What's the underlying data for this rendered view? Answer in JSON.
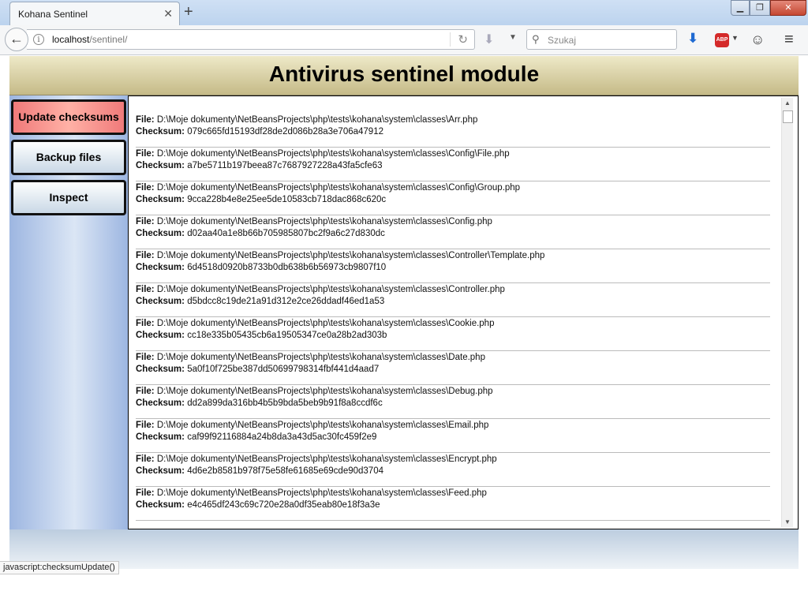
{
  "browser": {
    "tab_title": "Kohana Sentinel",
    "url_host": "localhost",
    "url_path": "/sentinel/",
    "search_placeholder": "Szukaj",
    "abp_label": "ABP",
    "status_text": "javascript:checksumUpdate()"
  },
  "page": {
    "title": "Antivirus sentinel module",
    "menu": [
      {
        "label": "Update checksums"
      },
      {
        "label": "Backup files"
      },
      {
        "label": "Inspect"
      }
    ],
    "file_label": "File:",
    "checksum_label": "Checksum:",
    "entries": [
      {
        "file": "D:\\Moje dokumenty\\NetBeansProjects\\php\\tests\\kohana\\system\\classes\\Arr.php",
        "checksum": "079c665fd15193df28de2d086b28a3e706a47912"
      },
      {
        "file": "D:\\Moje dokumenty\\NetBeansProjects\\php\\tests\\kohana\\system\\classes\\Config\\File.php",
        "checksum": "a7be5711b197beea87c7687927228a43fa5cfe63"
      },
      {
        "file": "D:\\Moje dokumenty\\NetBeansProjects\\php\\tests\\kohana\\system\\classes\\Config\\Group.php",
        "checksum": "9cca228b4e8e25ee5de10583cb718dac868c620c"
      },
      {
        "file": "D:\\Moje dokumenty\\NetBeansProjects\\php\\tests\\kohana\\system\\classes\\Config.php",
        "checksum": "d02aa40a1e8b66b705985807bc2f9a6c27d830dc"
      },
      {
        "file": "D:\\Moje dokumenty\\NetBeansProjects\\php\\tests\\kohana\\system\\classes\\Controller\\Template.php",
        "checksum": "6d4518d0920b8733b0db638b6b56973cb9807f10"
      },
      {
        "file": "D:\\Moje dokumenty\\NetBeansProjects\\php\\tests\\kohana\\system\\classes\\Controller.php",
        "checksum": "d5bdcc8c19de21a91d312e2ce26ddadf46ed1a53"
      },
      {
        "file": "D:\\Moje dokumenty\\NetBeansProjects\\php\\tests\\kohana\\system\\classes\\Cookie.php",
        "checksum": "cc18e335b05435cb6a19505347ce0a28b2ad303b"
      },
      {
        "file": "D:\\Moje dokumenty\\NetBeansProjects\\php\\tests\\kohana\\system\\classes\\Date.php",
        "checksum": "5a0f10f725be387dd50699798314fbf441d4aad7"
      },
      {
        "file": "D:\\Moje dokumenty\\NetBeansProjects\\php\\tests\\kohana\\system\\classes\\Debug.php",
        "checksum": "dd2a899da316bb4b5b9bda5beb9b91f8a8ccdf6c"
      },
      {
        "file": "D:\\Moje dokumenty\\NetBeansProjects\\php\\tests\\kohana\\system\\classes\\Email.php",
        "checksum": "caf99f92116884a24b8da3a43d5ac30fc459f2e9"
      },
      {
        "file": "D:\\Moje dokumenty\\NetBeansProjects\\php\\tests\\kohana\\system\\classes\\Encrypt.php",
        "checksum": "4d6e2b8581b978f75e58fe61685e69cde90d3704"
      },
      {
        "file": "D:\\Moje dokumenty\\NetBeansProjects\\php\\tests\\kohana\\system\\classes\\Feed.php",
        "checksum": "e4c465df243c69c720e28a0df35eab80e18f3a3e"
      }
    ]
  },
  "colors": {
    "header_gradient": [
      "#eee9c8",
      "#c5ba87"
    ],
    "active_button": "#f07a7a",
    "sidebar": "#9db6e1"
  }
}
